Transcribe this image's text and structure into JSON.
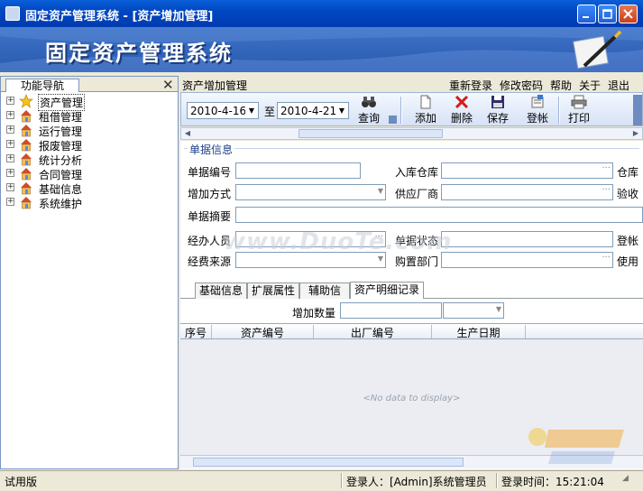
{
  "window": {
    "title": "固定资产管理系统  - [资产增加管理]"
  },
  "banner": {
    "brand": "固定资产管理系统"
  },
  "nav": {
    "tab_label": "功能导航",
    "items": [
      {
        "label": "资产管理",
        "selected": true,
        "icon": "star-icon"
      },
      {
        "label": "租借管理",
        "icon": "house-icon"
      },
      {
        "label": "运行管理",
        "icon": "house-icon"
      },
      {
        "label": "报废管理",
        "icon": "house-icon"
      },
      {
        "label": "统计分析",
        "icon": "house-icon"
      },
      {
        "label": "合同管理",
        "icon": "house-icon"
      },
      {
        "label": "基础信息",
        "icon": "house-icon"
      },
      {
        "label": "系统维护",
        "icon": "house-icon"
      }
    ]
  },
  "header": {
    "page_title": "资产增加管理",
    "links": [
      "重新登录",
      "修改密码",
      "帮助",
      "关于",
      "退出"
    ]
  },
  "toolbar": {
    "date_from": "2010-4-16",
    "date_sep": "至",
    "date_to": "2010-4-21",
    "query": "查询",
    "add": "添加",
    "delete": "删除",
    "save": "保存",
    "post": "登帐",
    "print": "打印"
  },
  "form": {
    "section_title": "单据信息",
    "doc_no": "单据编号",
    "warehouse_in": "入库仓库",
    "warehouse_cut": "仓库",
    "add_method": "增加方式",
    "supplier": "供应厂商",
    "accept_cut": "验收",
    "summary": "单据摘要",
    "handler": "经办人员",
    "doc_status": "单据状态",
    "post_cut": "登帐",
    "fund_source": "经费来源",
    "purchase_dept": "购置部门",
    "use_cut": "使用"
  },
  "tabs": [
    "基础信息",
    "扩展属性",
    "辅助信息",
    "资产明细记录"
  ],
  "detail": {
    "qty_label": "增加数量",
    "columns": [
      "序号",
      "资产编号",
      "出厂编号",
      "生产日期"
    ],
    "no_data": "<No data to display>"
  },
  "status": {
    "trial": "试用版",
    "login_user": "登录人：[Admin]系统管理员",
    "login_time": "登录时间：15:21:04"
  },
  "watermark": "www.DuoTe.com",
  "colors": {
    "titlebar": "#0047c2",
    "banner": "#2859ad",
    "accent": "#1d3f8a"
  }
}
